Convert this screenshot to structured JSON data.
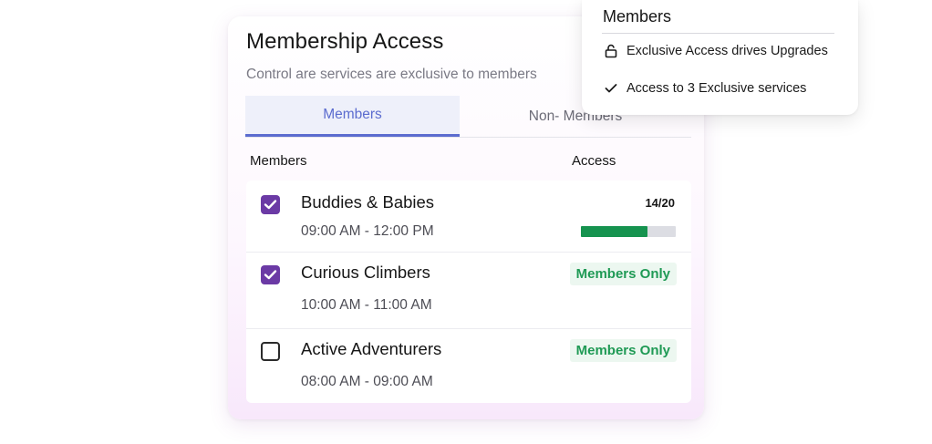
{
  "card": {
    "title": "Membership Access",
    "subtitle": "Control are services are exclusive to members",
    "tabs": [
      {
        "label": "Members",
        "active": true
      },
      {
        "label": "Non- Members",
        "active": false
      }
    ],
    "columns": {
      "left": "Members",
      "right": "Access"
    },
    "rows": [
      {
        "name": "Buddies & Babies",
        "time": "09:00 AM - 12:00 PM",
        "checked": true,
        "capacity": "14/20",
        "progress": 0.7
      },
      {
        "name": "Curious Climbers",
        "time": "10:00 AM - 11:00 AM",
        "checked": true,
        "badge": "Members Only"
      },
      {
        "name": "Active Adventurers",
        "time": "08:00 AM - 09:00 AM",
        "checked": false,
        "badge": "Members Only"
      }
    ]
  },
  "popover": {
    "title": "Members",
    "items": [
      {
        "icon": "lock-icon",
        "text": "Exclusive Access drives Upgrades"
      },
      {
        "icon": "check-icon",
        "text": "Access to 3 Exclusive services"
      }
    ]
  },
  "colors": {
    "accent": "#5b6ccf",
    "checkbox": "#6b3aa5",
    "success": "#16934f",
    "badge_bg": "#ecf7f0"
  }
}
